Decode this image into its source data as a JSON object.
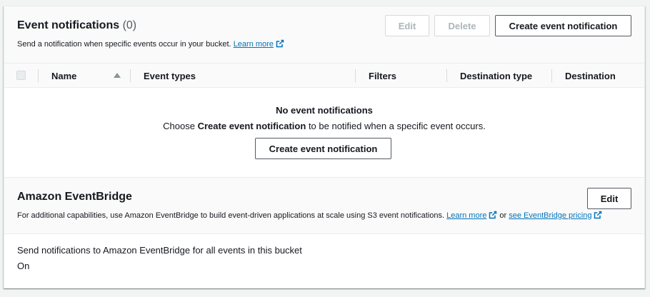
{
  "event_notifications": {
    "title": "Event notifications",
    "count": "(0)",
    "description": "Send a notification when specific events occur in your bucket.",
    "learn_more": "Learn more",
    "edit_label": "Edit",
    "delete_label": "Delete",
    "create_label": "Create event notification",
    "columns": [
      "Name",
      "Event types",
      "Filters",
      "Destination type",
      "Destination"
    ],
    "empty_title": "No event notifications",
    "empty_prefix": "Choose",
    "empty_bold": "Create event notification",
    "empty_suffix": "to be notified when a specific event occurs.",
    "empty_button": "Create event notification"
  },
  "eventbridge": {
    "title": "Amazon EventBridge",
    "edit_label": "Edit",
    "description": "For additional capabilities, use Amazon EventBridge to build event-driven applications at scale using S3 event notifications.",
    "learn_more": "Learn more",
    "or_text": "or",
    "pricing_link": "see EventBridge pricing",
    "setting_label": "Send notifications to Amazon EventBridge for all events in this bucket",
    "setting_value": "On"
  },
  "colors": {
    "link": "#0073bb",
    "text": "#16191f",
    "disabled": "#aab7b8"
  },
  "icons": {
    "external_link": "external-link-icon",
    "sort": "sort-ascending-icon"
  }
}
